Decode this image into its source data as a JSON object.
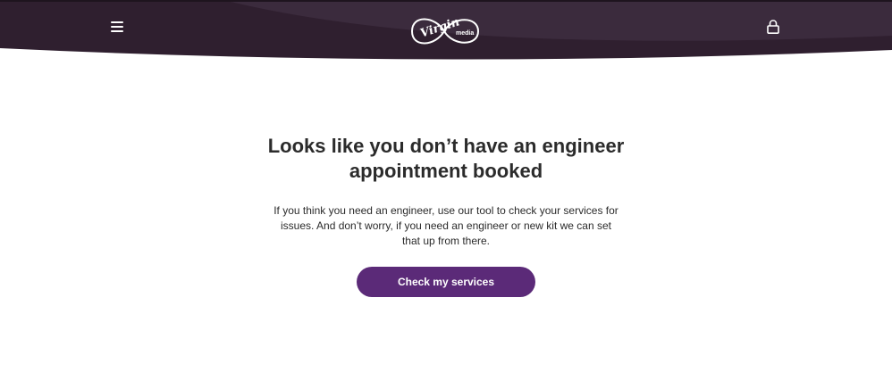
{
  "header": {
    "logo_icon": "virgin-media-logo",
    "menu_icon": "hamburger-menu-icon",
    "account_icon": "lock-icon",
    "logo_text_script": "Virgin",
    "logo_text_media": "media"
  },
  "main": {
    "headline": "Looks like you don’t have an engineer appointment booked",
    "body": "If you think you need an engineer, use our tool to check your services for issues. And don’t worry, if you need an engineer or new kit we can set that up from there.",
    "cta_label": "Check my services"
  },
  "colors": {
    "header_dark": "#2f1f2f",
    "header_band": "#3d2c3f",
    "accent_purple": "#5b2a78",
    "text": "#2b2b2b",
    "background": "#ffffff"
  }
}
